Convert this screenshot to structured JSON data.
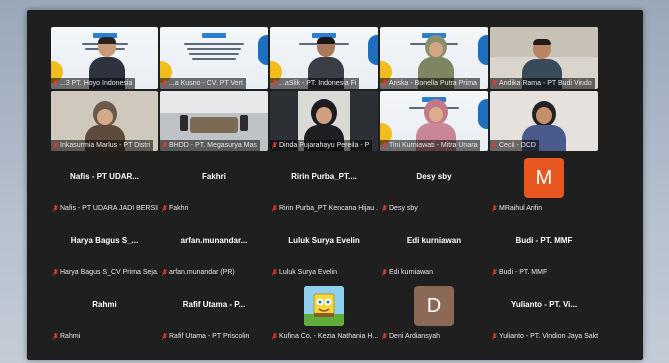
{
  "colors": {
    "background": "#1f1f1f",
    "label_bg": "rgba(0,0,0,0.55)",
    "muted_mic": "#e03b3b",
    "avatar_orange": "#e8571f",
    "avatar_brown": "#8a6a56",
    "slide_accent": "#2a7fd0"
  },
  "video_tiles": [
    {
      "label": "...3 PT. Hoyo Indonesia",
      "kind": "slide-person"
    },
    {
      "label": "...a Kusno - CV. PT Vert",
      "kind": "slide"
    },
    {
      "label": "...aSlik - PT. Indonesia Fi",
      "kind": "slide-person"
    },
    {
      "label": "Ariska - Bonella Putra Prima",
      "kind": "slide-person"
    },
    {
      "label": "Andika Rama - PT Budi Vindo",
      "kind": "person"
    },
    {
      "label": "Inkasurmia Marlus - PT Distri",
      "kind": "person"
    },
    {
      "label": "BHDD - PT. Megasurya Mas",
      "kind": "room"
    },
    {
      "label": "Dinda Pujarahayu Pereila - P",
      "kind": "person"
    },
    {
      "label": "Tini Kurniawati - Mitra Unara",
      "kind": "slide-person"
    },
    {
      "label": "Cecil - DCD",
      "kind": "person"
    }
  ],
  "audio_tiles": [
    {
      "name": "Nafis - PT UDAR...",
      "label": "Nafis - PT UDARA JADI BERSIH",
      "avatar": "none"
    },
    {
      "name": "Fakhri",
      "label": "Fakhri",
      "avatar": "none"
    },
    {
      "name": "Ririn Purba_PT....",
      "label": "Ririn Purba_PT Kencana Hijau ...",
      "avatar": "none"
    },
    {
      "name": "Desy sby",
      "label": "Desy sby",
      "avatar": "none"
    },
    {
      "name": "",
      "label": "MRaihul Arifin",
      "avatar": "letter",
      "letter": "M"
    },
    {
      "name": "Harya Bagus S_...",
      "label": "Harya Bagus S_CV Prima Seja...",
      "avatar": "none"
    },
    {
      "name": "arfan.munandar...",
      "label": "arfan.munandar (PR)",
      "avatar": "none"
    },
    {
      "name": "Luluk Surya Evelin",
      "label": "Luluk Surya Evelin",
      "avatar": "none"
    },
    {
      "name": "Edi kurniawan",
      "label": "Edi kurniawan",
      "avatar": "none"
    },
    {
      "name": "Budi - PT. MMF",
      "label": "Budi - PT. MMF",
      "avatar": "none"
    },
    {
      "name": "Rahmi",
      "label": "Rahmi",
      "avatar": "none"
    },
    {
      "name": "Rafif Utama - P...",
      "label": "Rafif Utama - PT Priscolin",
      "avatar": "none"
    },
    {
      "name": "",
      "label": "Kufina Co. - Kezia Nathania H...",
      "avatar": "image",
      "image": "cartoon-avatar"
    },
    {
      "name": "",
      "label": "Deni Ardiansyah",
      "avatar": "letter",
      "letter": "D"
    },
    {
      "name": "Yulianto - PT. Vi...",
      "label": "Yulianto - PT. Vindion Jaya Sakti",
      "avatar": "none"
    }
  ]
}
